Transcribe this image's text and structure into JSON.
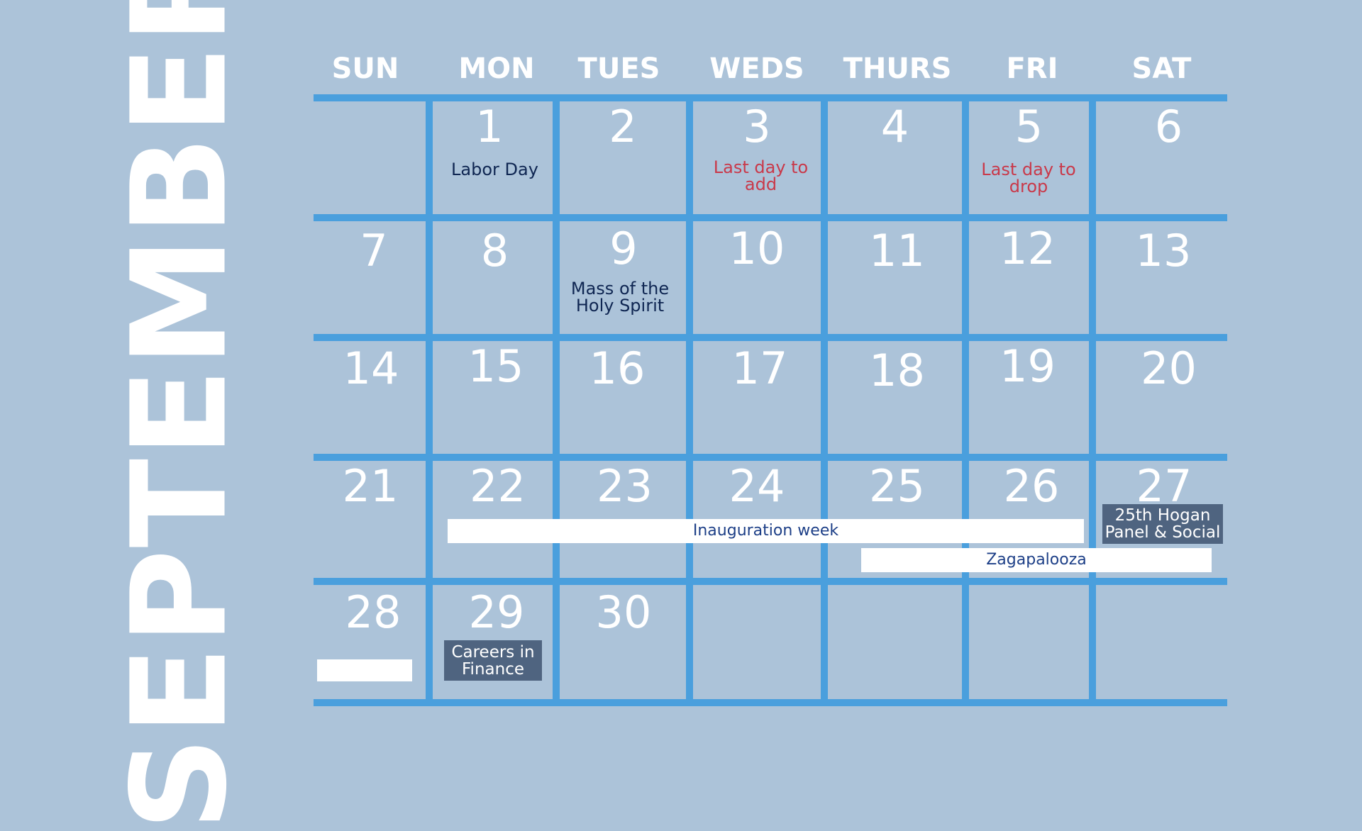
{
  "month": "SEPTEMBER",
  "weekdays": [
    "SUN",
    "MON",
    "TUES",
    "WEDS",
    "THURS",
    "FRI",
    "SAT"
  ],
  "dates": [
    "1",
    "2",
    "3",
    "4",
    "5",
    "6",
    "7",
    "8",
    "9",
    "10",
    "11",
    "12",
    "13",
    "14",
    "15",
    "16",
    "17",
    "18",
    "19",
    "20",
    "21",
    "22",
    "23",
    "24",
    "25",
    "26",
    "27",
    "28",
    "29",
    "30"
  ],
  "events": {
    "labor_day": "Labor Day",
    "last_day_add": "Last day to add",
    "last_day_drop": "Last day to drop",
    "mass": "Mass of the Holy Spirit",
    "inauguration": "Inauguration week",
    "zagapalooza": "Zagapalooza",
    "hogan": "25th Hogan Panel & Social",
    "careers": "Careers in Finance"
  },
  "colors": {
    "background": "#acc3d9",
    "grid": "#4a9fdd",
    "event_red": "#c9394a",
    "event_dark": "#0f2652",
    "chip": "#4f6480"
  }
}
